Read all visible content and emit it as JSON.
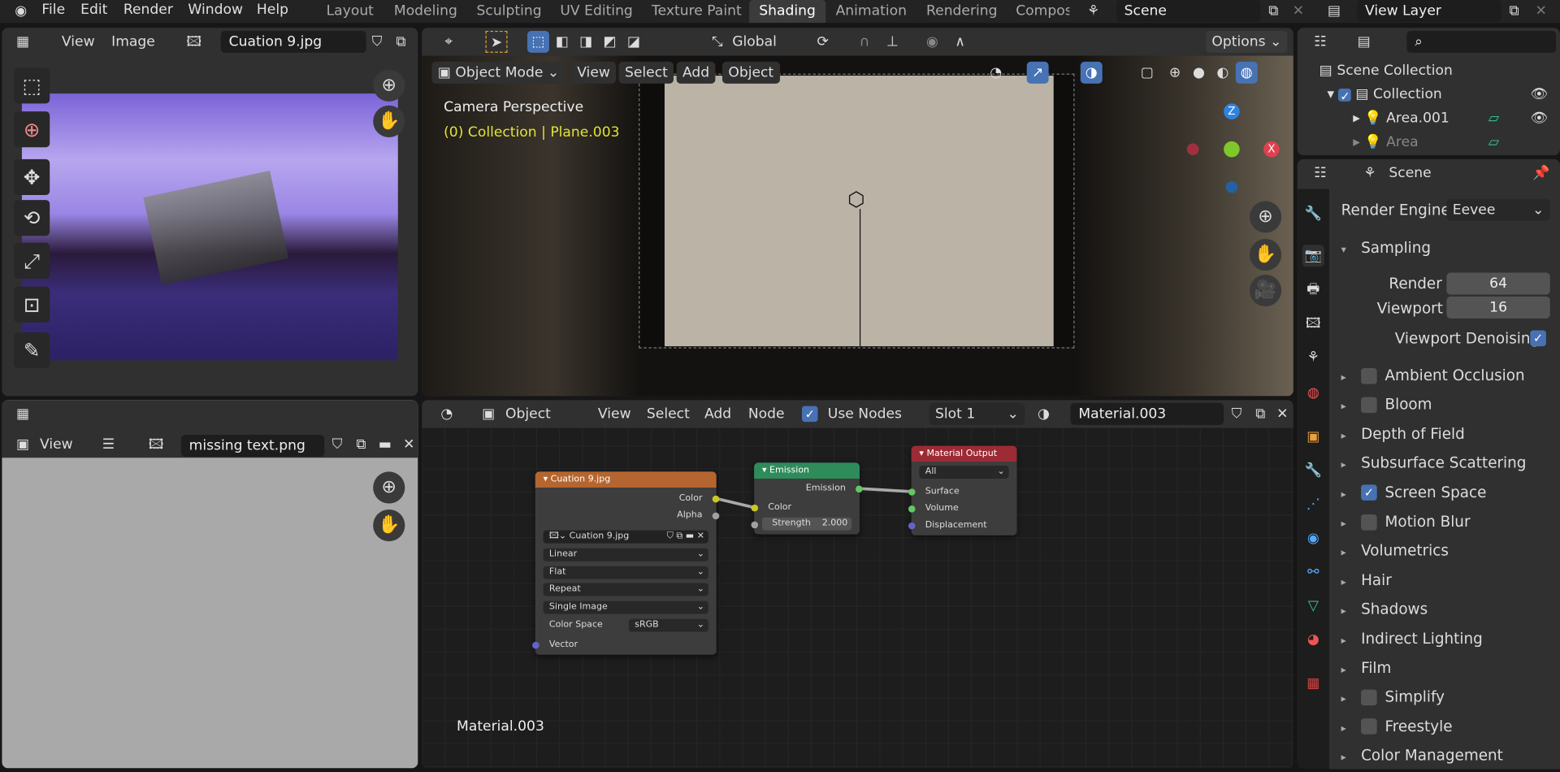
{
  "menubar": {
    "items": [
      "File",
      "Edit",
      "Render",
      "Window",
      "Help"
    ]
  },
  "workspaces": {
    "tabs": [
      "Layout",
      "Modeling",
      "Sculpting",
      "UV Editing",
      "Texture Paint",
      "Shading",
      "Animation",
      "Rendering",
      "Compos"
    ],
    "active": "Shading"
  },
  "scene": {
    "name": "Scene"
  },
  "view_layer": {
    "name": "View Layer"
  },
  "image_editor": {
    "menus": [
      "View",
      "Image"
    ],
    "image_name": "Cuation 9.jpg"
  },
  "image_editor2": {
    "view": "View",
    "image_name": "missing text.png"
  },
  "viewport": {
    "transform_orientation": "Global",
    "options": "Options",
    "mode": "Object Mode",
    "menus": [
      "View",
      "Select",
      "Add",
      "Object"
    ],
    "camera_label": "Camera Perspective",
    "collection_label": "(0) Collection | Plane.003",
    "axes": {
      "z": "Z",
      "x": "X"
    }
  },
  "node_editor": {
    "object": "Object",
    "menus": [
      "View",
      "Select",
      "Add",
      "Node"
    ],
    "use_nodes_label": "Use Nodes",
    "use_nodes": true,
    "slot": "Slot 1",
    "material": "Material.003",
    "material_label": "Material.003",
    "image_node": {
      "title": "Cuation 9.jpg",
      "outputs": [
        "Color",
        "Alpha"
      ],
      "image": "Cuation 9.jpg",
      "interpolation": "Linear",
      "projection": "Flat",
      "extension": "Repeat",
      "source": "Single Image",
      "color_space_label": "Color Space",
      "color_space": "sRGB",
      "input": "Vector"
    },
    "emission_node": {
      "title": "Emission",
      "output": "Emission",
      "input_color": "Color",
      "strength_label": "Strength",
      "strength": "2.000"
    },
    "output_node": {
      "title": "Material Output",
      "target": "All",
      "inputs": [
        "Surface",
        "Volume",
        "Displacement"
      ]
    }
  },
  "outliner": {
    "root": "Scene Collection",
    "collection": "Collection",
    "items": [
      "Area.001",
      "Area"
    ]
  },
  "properties": {
    "context": "Scene",
    "render_engine_label": "Render Engine",
    "render_engine": "Eevee",
    "sampling": {
      "title": "Sampling",
      "render_label": "Render",
      "render": "64",
      "viewport_label": "Viewport",
      "viewport": "16",
      "denoise_label": "Viewport Denoising",
      "denoise": true
    },
    "panels": [
      {
        "label": "Ambient Occlusion",
        "checkbox": true,
        "checked": false
      },
      {
        "label": "Bloom",
        "checkbox": true,
        "checked": false
      },
      {
        "label": "Depth of Field",
        "checkbox": false
      },
      {
        "label": "Subsurface Scattering",
        "checkbox": false
      },
      {
        "label": "Screen Space Reflections",
        "checkbox": true,
        "checked": true
      },
      {
        "label": "Motion Blur",
        "checkbox": true,
        "checked": false
      },
      {
        "label": "Volumetrics",
        "checkbox": false
      },
      {
        "label": "Hair",
        "checkbox": false
      },
      {
        "label": "Shadows",
        "checkbox": false
      },
      {
        "label": "Indirect Lighting",
        "checkbox": false
      },
      {
        "label": "Film",
        "checkbox": false
      },
      {
        "label": "Simplify",
        "checkbox": true,
        "checked": false
      },
      {
        "label": "Freestyle",
        "checkbox": true,
        "checked": false
      },
      {
        "label": "Color Management",
        "checkbox": false
      }
    ]
  },
  "colors": {
    "accent": "#4772b3",
    "image_node": "#b5652f",
    "emission_node": "#2e8b5a",
    "output_node": "#9b2b35",
    "collection_text": "#e2e23a"
  }
}
